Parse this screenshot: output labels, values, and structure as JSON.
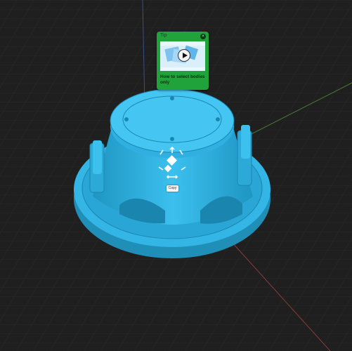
{
  "tip": {
    "title": "Tip",
    "close_glyph": "×",
    "caption": "How to select bodies only",
    "thumbnail_icon": "play-icon"
  },
  "toolbar": {
    "copy_label": "Copy"
  },
  "colors": {
    "background": "#1f1f1f",
    "grid": "#2b2b2b",
    "model": "#33b5e5",
    "x_axis": "#8a3b3b",
    "y_axis": "#4a7a3a",
    "z_axis": "#3b4f8a",
    "tip_green": "#1fa33a"
  },
  "icons": [
    "move-arrow-icon",
    "rotate-handle-icon",
    "scale-handle-icon",
    "close-icon",
    "play-icon"
  ]
}
